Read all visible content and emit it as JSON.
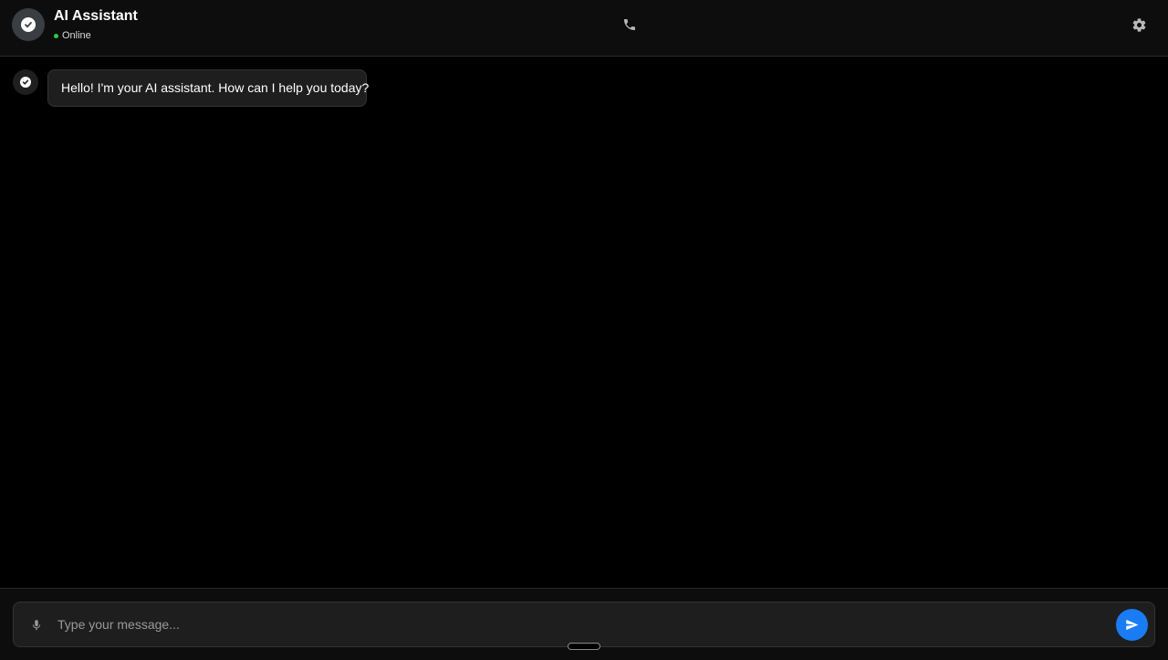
{
  "header": {
    "title": "AI Assistant",
    "status": "Online",
    "status_color": "#2ecc40",
    "avatar_icon": "check-circle-icon",
    "call_icon": "phone-icon",
    "settings_icon": "gear-icon"
  },
  "messages": [
    {
      "sender": "assistant",
      "avatar_icon": "check-circle-icon",
      "text": "Hello! I'm your AI assistant. How can I help you today?"
    }
  ],
  "composer": {
    "placeholder": "Type your message...",
    "value": "",
    "mic_icon": "microphone-icon",
    "send_icon": "send-icon",
    "send_color": "#1a7cf5"
  },
  "colors": {
    "background": "#000000",
    "header_bg": "#0d0d0d",
    "bubble_bg": "#1e1e1e"
  }
}
